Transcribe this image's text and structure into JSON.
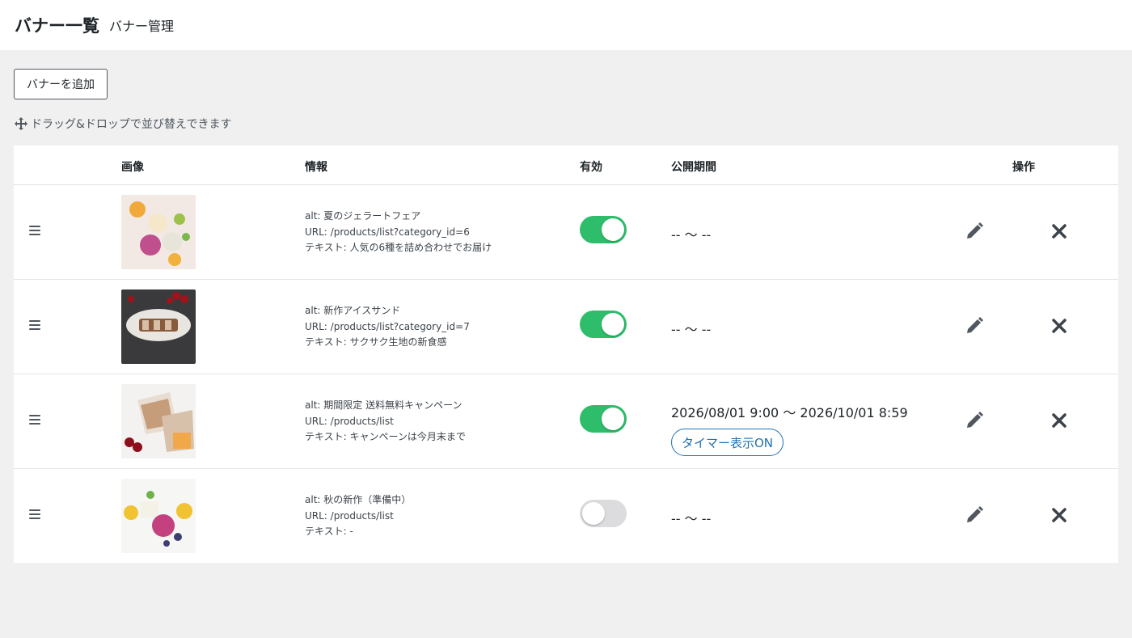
{
  "header": {
    "title": "バナー一覧",
    "subtitle": "バナー管理"
  },
  "actions": {
    "add_label": "バナーを追加"
  },
  "hint": {
    "icon": "move-arrows-icon",
    "text": "ドラッグ&ドロップで並び替えできます"
  },
  "table": {
    "columns": [
      "画像",
      "情報",
      "有効",
      "公開期間",
      "操作"
    ],
    "rows": [
      {
        "alt": "alt: 夏のジェラートフェア",
        "url": "URL: /products/list?category_id=6",
        "text": "テキスト: 人気の6種を詰め合わせでお届け",
        "enabled": true,
        "period": "-- 〜 --",
        "timer": ""
      },
      {
        "alt": "alt: 新作アイスサンド",
        "url": "URL: /products/list?category_id=7",
        "text": "テキスト: サクサク生地の新食感",
        "enabled": true,
        "period": "-- 〜 --",
        "timer": ""
      },
      {
        "alt": "alt: 期間限定 送料無料キャンペーン",
        "url": "URL: /products/list",
        "text": "テキスト: キャンペーンは今月末まで",
        "enabled": true,
        "period": "2026/08/01 9:00 〜 2026/10/01 8:59",
        "timer": "タイマー表示ON"
      },
      {
        "alt": "alt: 秋の新作（準備中）",
        "url": "URL: /products/list",
        "text": "テキスト: -",
        "enabled": false,
        "period": "-- 〜 --",
        "timer": ""
      }
    ]
  },
  "colors": {
    "toggle_on": "#2ebd6b",
    "toggle_off": "#dcdcde",
    "accent": "#2271b1",
    "background": "#f0f0f1"
  },
  "icons": {
    "drag": "drag-handle-icon",
    "edit": "pencil-icon",
    "delete": "close-icon"
  }
}
